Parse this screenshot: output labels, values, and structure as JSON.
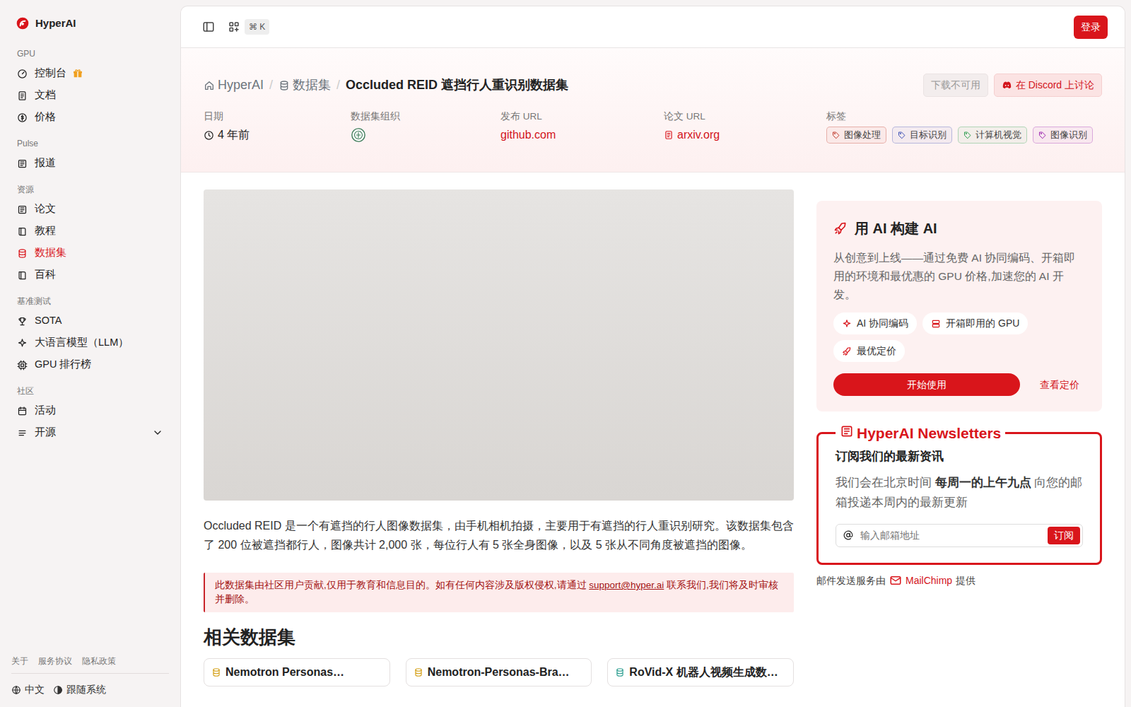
{
  "sidebar": {
    "brand": "HyperAI",
    "groups": [
      {
        "title": "GPU",
        "items": [
          {
            "label": "控制台",
            "kind": "gift",
            "selected": false
          },
          {
            "label": "文档",
            "kind": "link",
            "selected": false
          },
          {
            "label": "价格",
            "kind": "link",
            "selected": false
          }
        ]
      },
      {
        "title": "Pulse",
        "items": [
          {
            "label": "报道",
            "kind": "link",
            "selected": false
          }
        ]
      },
      {
        "title": "资源",
        "items": [
          {
            "label": "论文",
            "kind": "link",
            "selected": false
          },
          {
            "label": "教程",
            "kind": "link",
            "selected": false
          },
          {
            "label": "数据集",
            "kind": "link",
            "selected": true
          },
          {
            "label": "百科",
            "kind": "link",
            "selected": false
          }
        ]
      },
      {
        "title": "基准测试",
        "items": [
          {
            "label": "SOTA",
            "kind": "link",
            "selected": false
          },
          {
            "label": "大语言模型（LLM）",
            "kind": "link",
            "selected": false
          },
          {
            "label": "GPU 排行榜",
            "kind": "link",
            "selected": false
          }
        ]
      },
      {
        "title": "社区",
        "items": [
          {
            "label": "活动",
            "kind": "link",
            "selected": false
          },
          {
            "label": "开源",
            "kind": "group",
            "selected": false
          }
        ]
      }
    ],
    "footer_links": [
      "关于",
      "服务协议",
      "隐私政策"
    ],
    "language": "中文",
    "theme": "跟随系统"
  },
  "topbar": {
    "shortcut": "⌘ K",
    "login": "登录"
  },
  "hero": {
    "breadcrumb": {
      "separator": "/",
      "items": [
        "HyperAI",
        "数据集",
        "Occluded REID 遮挡行人重识别数据集"
      ]
    },
    "actions": {
      "download": {
        "label": "下载不可用",
        "disabled": true
      },
      "discord": {
        "label": "在 Discord 上讨论"
      }
    },
    "meta": [
      {
        "label": "日期",
        "value": "4 年前",
        "kind": "time"
      },
      {
        "label": "数据集组织",
        "kind": "logo"
      },
      {
        "label": "发布 URL",
        "value": "github.com",
        "kind": "link"
      },
      {
        "label": "论文 URL",
        "value": "arxiv.org",
        "kind": "paper"
      }
    ],
    "tags": {
      "label": "标签",
      "items": [
        {
          "label": "图像处理",
          "color": "#c0392b"
        },
        {
          "label": "目标识别",
          "color": "#3f51b5"
        },
        {
          "label": "计算机视觉",
          "color": "#2e9e4f"
        },
        {
          "label": "图像识别",
          "color": "#9c27b0"
        }
      ]
    }
  },
  "content": {
    "description": "Occluded REID 是一个有遮挡的行人图像数据集，由手机相机拍摄，主要用于有遮挡的行人重识别研究。该数据集包含了 200 位被遮挡都行人，图像共计 2,000 张，每位行人有 5 张全身图像，以及 5 张从不同角度被遮挡的图像。",
    "notice": {
      "prefix": "此数据集由社区用户贡献,仅用于教育和信息目的。如有任何内容涉及版权侵权,请通过 ",
      "email": "support@hyper.ai",
      "suffix": " 联系我们,我们将及时审核并删除。"
    },
    "related": {
      "title": "相关数据集",
      "items": [
        {
          "title": "Nemotron Personas…",
          "color": "#d4a017"
        },
        {
          "title": "Nemotron-Personas-Bra…",
          "color": "#d4a017"
        },
        {
          "title": "RoVid-X 机器人视频生成数…",
          "color": "#2a9d8f"
        }
      ]
    }
  },
  "promo": {
    "title": "用 AI 构建 AI",
    "text": "从创意到上线——通过免费 AI 协同编码、开箱即用的环境和最优惠的 GPU 价格,加速您的 AI 开发。",
    "features": [
      "AI 协同编码",
      "开箱即用的 GPU",
      "最优定价"
    ],
    "start": "开始使用",
    "pricing": "查看定价"
  },
  "newsletter": {
    "title": "HyperAI Newsletters",
    "subtitle": "订阅我们的最新资讯",
    "text": {
      "before": "我们会在北京时间 ",
      "bold": "每周一的上午九点",
      "after": " 向您的邮箱投递本周内的最新更新"
    },
    "placeholder": "输入邮箱地址",
    "button": "订阅",
    "footer": {
      "before": "邮件发送服务由",
      "brand": "MailChimp",
      "after": "提供"
    }
  }
}
